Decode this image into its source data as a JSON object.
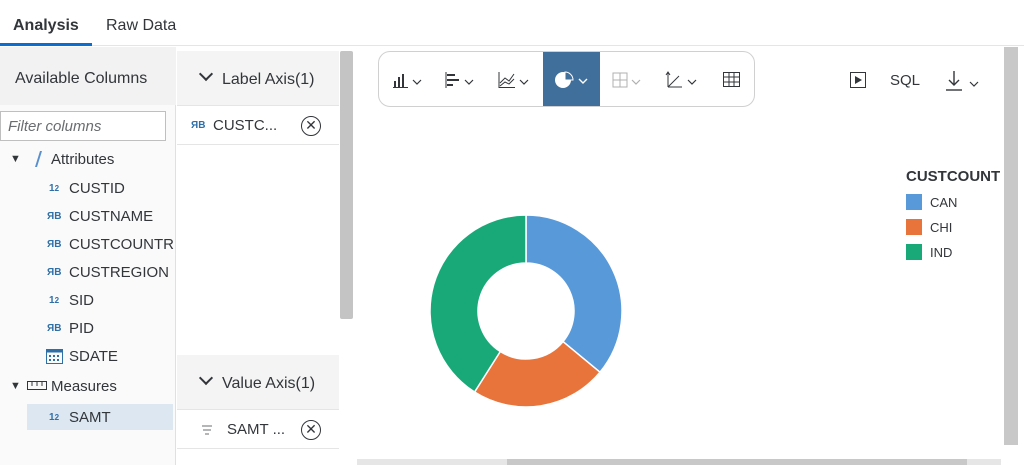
{
  "tabs": [
    {
      "label": "Analysis",
      "active": true
    },
    {
      "label": "Raw Data",
      "active": false
    }
  ],
  "available_columns": {
    "title": "Available Columns",
    "filter_placeholder": "Filter columns",
    "attributes_label": "Attributes",
    "attributes": [
      {
        "type": "12",
        "name": "CUSTID"
      },
      {
        "type": "AB",
        "name": "CUSTNAME"
      },
      {
        "type": "AB",
        "name": "CUSTCOUNTR"
      },
      {
        "type": "AB",
        "name": "CUSTREGION"
      },
      {
        "type": "12",
        "name": "SID"
      },
      {
        "type": "AB",
        "name": "PID"
      },
      {
        "type": "calendar",
        "name": "SDATE"
      }
    ],
    "measures_label": "Measures",
    "measures": [
      {
        "type": "12",
        "name": "SAMT"
      }
    ]
  },
  "label_axis": {
    "title": "Label Axis(1)",
    "item_type": "AB",
    "item_label": "CUSTC..."
  },
  "value_axis": {
    "title": "Value Axis(1)",
    "item_label": "SAMT ..."
  },
  "toolbar": {
    "buttons": [
      "bar-chart-icon",
      "horizontal-bar-icon",
      "line-chart-icon",
      "pie-chart-icon",
      "scatter-icon",
      "axis-icon",
      "table-icon"
    ],
    "active": "pie-chart-icon",
    "sql_label": "SQL"
  },
  "chart_data": {
    "type": "pie",
    "variant": "donut",
    "legend_title": "CUSTCOUNT",
    "legend_position": "right",
    "categories": [
      "CAN",
      "CHI",
      "IND"
    ],
    "values": [
      36,
      23,
      41
    ],
    "colors": [
      "#5899da",
      "#e8743b",
      "#19a979"
    ]
  }
}
